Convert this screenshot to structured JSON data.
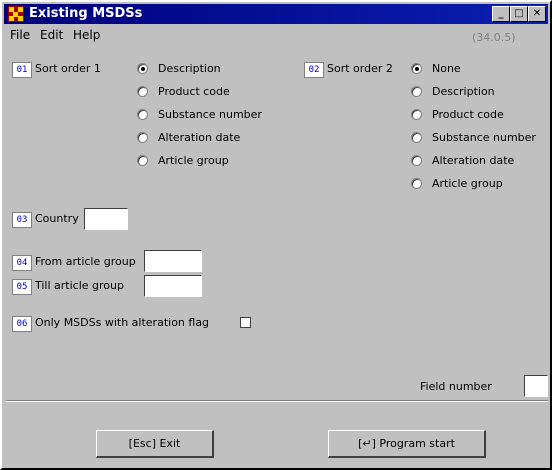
{
  "window": {
    "title": "Existing MSDSs",
    "minimize": "_",
    "maximize": "□",
    "close": "✕"
  },
  "menu": {
    "file": "File",
    "edit": "Edit",
    "help": "Help"
  },
  "coords": "(34.0.5)",
  "sort1": {
    "num": "01",
    "label": "Sort order 1",
    "options": [
      "Description",
      "Product code",
      "Substance number",
      "Alteration date",
      "Article group"
    ],
    "selected": "Description"
  },
  "sort2": {
    "num": "02",
    "label": "Sort order 2",
    "options": [
      "None",
      "Description",
      "Product code",
      "Substance number",
      "Alteration date",
      "Article group"
    ],
    "selected": "None"
  },
  "country": {
    "num": "03",
    "label": "Country",
    "value": ""
  },
  "from_group": {
    "num": "04",
    "label": "From article group",
    "value": ""
  },
  "till_group": {
    "num": "05",
    "label": "Till article group",
    "value": ""
  },
  "alteration_flag": {
    "num": "06",
    "label": "Only MSDSs with alteration flag",
    "checked": false
  },
  "field_number": {
    "label": "Field number",
    "value": ""
  },
  "buttons": {
    "exit": "[Esc] Exit",
    "start": "[↵] Program start"
  }
}
